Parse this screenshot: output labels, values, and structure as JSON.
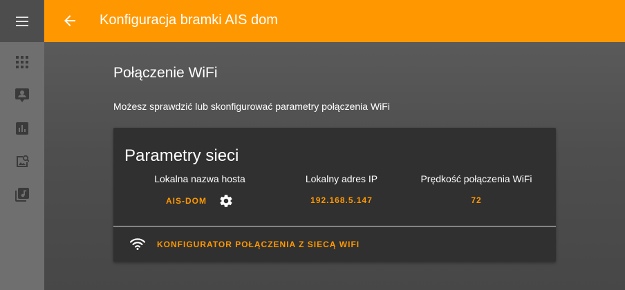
{
  "header": {
    "title": "Konfiguracja bramki AIS dom",
    "back_icon": "arrow-left-icon"
  },
  "sidebar": {
    "menu_icon": "hamburger-menu-icon",
    "items": [
      {
        "icon": "apps-grid-icon"
      },
      {
        "icon": "account-box-icon"
      },
      {
        "icon": "bar-chart-icon"
      },
      {
        "icon": "image-search-icon"
      },
      {
        "icon": "music-library-icon"
      }
    ]
  },
  "section": {
    "title": "Połączenie WiFi",
    "description": "Możesz sprawdzić lub skonfigurować parametry połączenia WiFi"
  },
  "card": {
    "title": "Parametry sieci",
    "host_label": "Lokalna nazwa hosta",
    "host_value": "AIS-DOM",
    "ip_label": "Lokalny adres IP",
    "ip_value": "192.168.5.147",
    "speed_label": "Prędkość połączenia WiFi",
    "speed_value": "72",
    "action_label": "KONFIGURATOR POŁĄCZENIA Z SIECĄ WIFI",
    "action_icon": "wifi-icon",
    "settings_icon": "gear-icon"
  },
  "colors": {
    "accent": "#ff9800",
    "card_bg": "#303030",
    "sidebar_bg": "#6f6f6f",
    "main_bg": "#4a4a4a"
  }
}
